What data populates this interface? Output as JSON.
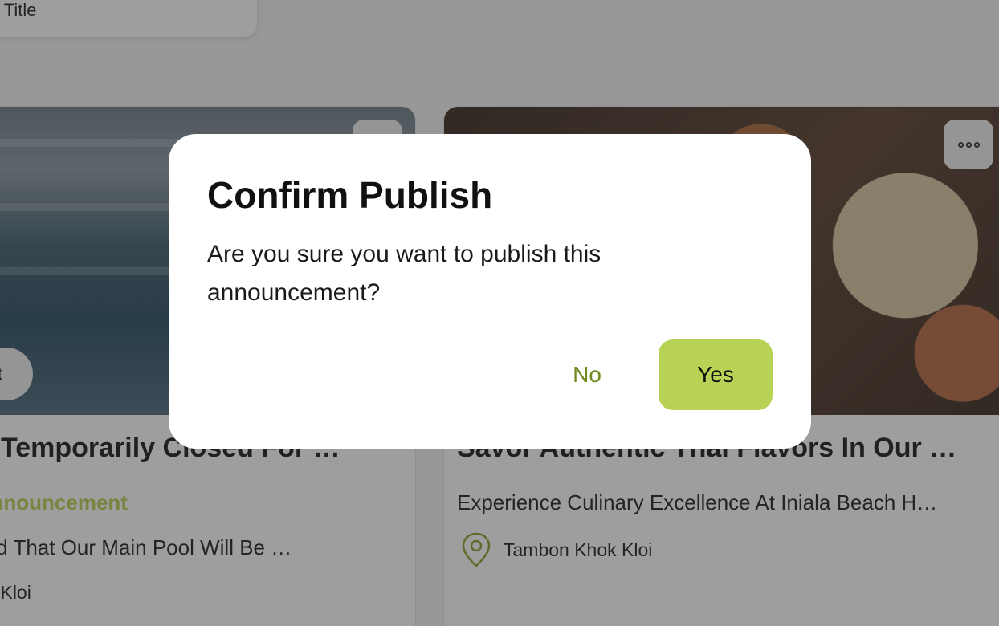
{
  "page": {
    "sort_label": "y Title"
  },
  "cards": [
    {
      "title": " Temporarily Closed For Re…",
      "category": "e Announcement",
      "description": "vised That Our Main Pool Will Be Cl…",
      "location": "hok Kloi",
      "badge": "nt"
    },
    {
      "title": "Savor Authentic Thai Flavors In Our …",
      "description": "Experience Culinary Excellence At Iniala Beach H…",
      "location": "Tambon Khok Kloi"
    }
  ],
  "dialog": {
    "title": "Confirm Publish",
    "message": "Are you sure you want to publish this announcement?",
    "no_label": "No",
    "yes_label": "Yes"
  },
  "icons": {
    "more": "more-dots-icon",
    "location": "map-pin-icon"
  },
  "colors": {
    "accent": "#b7d254",
    "accent_text": "#6f8a1e",
    "category": "#b8d155"
  }
}
